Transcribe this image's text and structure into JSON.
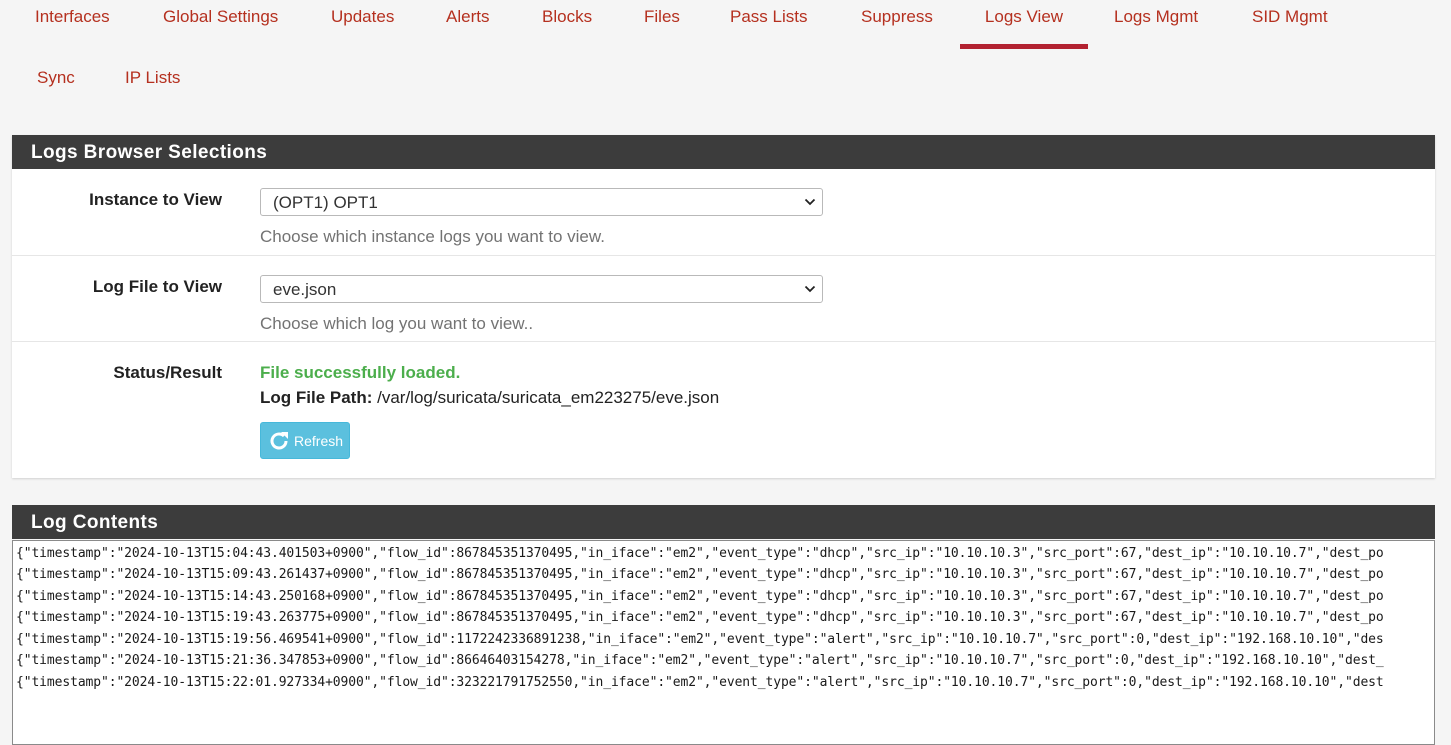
{
  "tabs": [
    {
      "label": "Interfaces"
    },
    {
      "label": "Global Settings"
    },
    {
      "label": "Updates"
    },
    {
      "label": "Alerts"
    },
    {
      "label": "Blocks"
    },
    {
      "label": "Files"
    },
    {
      "label": "Pass Lists"
    },
    {
      "label": "Suppress"
    },
    {
      "label": "Logs View",
      "active": true
    },
    {
      "label": "Logs Mgmt"
    },
    {
      "label": "SID Mgmt"
    },
    {
      "label": "Sync"
    },
    {
      "label": "IP Lists"
    }
  ],
  "browser": {
    "heading": "Logs Browser Selections",
    "instance": {
      "label": "Instance to View",
      "value": "(OPT1) OPT1",
      "help": "Choose which instance logs you want to view."
    },
    "logfile": {
      "label": "Log File to View",
      "value": "eve.json",
      "help": "Choose which log you want to view.."
    },
    "status": {
      "label": "Status/Result",
      "message": "File successfully loaded.",
      "path_label": "Log File Path:",
      "path_value": "/var/log/suricata/suricata_em223275/eve.json"
    },
    "refresh_label": "Refresh"
  },
  "log": {
    "heading": "Log Contents",
    "lines": [
      "{\"timestamp\":\"2024-10-13T15:04:43.401503+0900\",\"flow_id\":867845351370495,\"in_iface\":\"em2\",\"event_type\":\"dhcp\",\"src_ip\":\"10.10.10.3\",\"src_port\":67,\"dest_ip\":\"10.10.10.7\",\"dest_po",
      "{\"timestamp\":\"2024-10-13T15:09:43.261437+0900\",\"flow_id\":867845351370495,\"in_iface\":\"em2\",\"event_type\":\"dhcp\",\"src_ip\":\"10.10.10.3\",\"src_port\":67,\"dest_ip\":\"10.10.10.7\",\"dest_po",
      "{\"timestamp\":\"2024-10-13T15:14:43.250168+0900\",\"flow_id\":867845351370495,\"in_iface\":\"em2\",\"event_type\":\"dhcp\",\"src_ip\":\"10.10.10.3\",\"src_port\":67,\"dest_ip\":\"10.10.10.7\",\"dest_po",
      "{\"timestamp\":\"2024-10-13T15:19:43.263775+0900\",\"flow_id\":867845351370495,\"in_iface\":\"em2\",\"event_type\":\"dhcp\",\"src_ip\":\"10.10.10.3\",\"src_port\":67,\"dest_ip\":\"10.10.10.7\",\"dest_po",
      "{\"timestamp\":\"2024-10-13T15:19:56.469541+0900\",\"flow_id\":1172242336891238,\"in_iface\":\"em2\",\"event_type\":\"alert\",\"src_ip\":\"10.10.10.7\",\"src_port\":0,\"dest_ip\":\"192.168.10.10\",\"des",
      "{\"timestamp\":\"2024-10-13T15:21:36.347853+0900\",\"flow_id\":86646403154278,\"in_iface\":\"em2\",\"event_type\":\"alert\",\"src_ip\":\"10.10.10.7\",\"src_port\":0,\"dest_ip\":\"192.168.10.10\",\"dest_",
      "{\"timestamp\":\"2024-10-13T15:22:01.927334+0900\",\"flow_id\":323221791752550,\"in_iface\":\"em2\",\"event_type\":\"alert\",\"src_ip\":\"10.10.10.7\",\"src_port\":0,\"dest_ip\":\"192.168.10.10\",\"dest"
    ]
  },
  "colors": {
    "tab_text": "#b5301f",
    "tab_active_bar": "#b22130",
    "panel_heading_bg": "#3c3c3c",
    "success_text": "#4cae4c",
    "refresh_button": "#5bc0de"
  },
  "icons": {
    "select_chevron": "chevron-down-icon",
    "refresh": "refresh-icon"
  }
}
